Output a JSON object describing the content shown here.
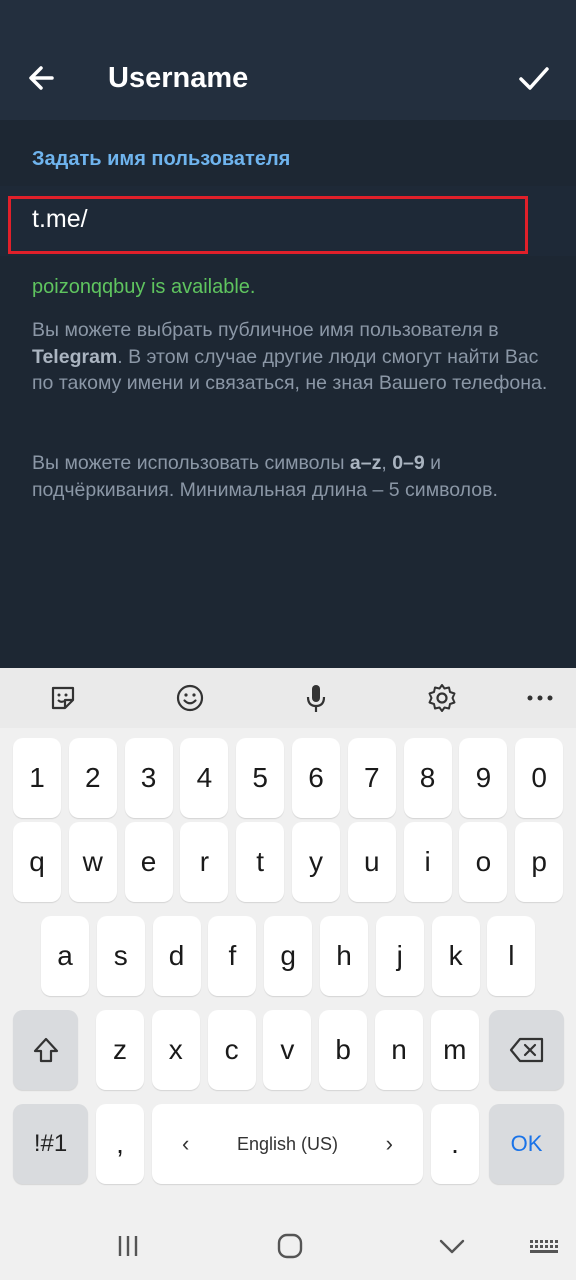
{
  "header": {
    "title": "Username"
  },
  "section_title": "Задать имя пользователя",
  "input": {
    "prefix": "t.me/",
    "value": ""
  },
  "status": "poizonqqbuy is available.",
  "help1": {
    "part1": "Вы можете выбрать публичное имя пользователя в ",
    "brand": "Telegram",
    "part2": ". В этом случае другие люди смогут найти Вас по такому имени и связаться, не зная Вашего телефона."
  },
  "help2": {
    "part1": "Вы можете использовать символы ",
    "chars": "a–z",
    "sep1": ", ",
    "digits": "0–9",
    "part2": " и подчёркивания. Минимальная длина – 5 символов."
  },
  "keyboard": {
    "toolbar": [
      "sticker-icon",
      "emoji-icon",
      "mic-icon",
      "settings-icon",
      "more-icon"
    ],
    "row_numbers": [
      "1",
      "2",
      "3",
      "4",
      "5",
      "6",
      "7",
      "8",
      "9",
      "0"
    ],
    "row1": [
      "q",
      "w",
      "e",
      "r",
      "t",
      "y",
      "u",
      "i",
      "o",
      "p"
    ],
    "row2": [
      "a",
      "s",
      "d",
      "f",
      "g",
      "h",
      "j",
      "k",
      "l"
    ],
    "row3": [
      "z",
      "x",
      "c",
      "v",
      "b",
      "n",
      "m"
    ],
    "symbols_label": "!#1",
    "comma": ",",
    "space_label": "English (US)",
    "space_left": "‹",
    "space_right": "›",
    "period": ".",
    "enter_label": "OK"
  },
  "colors": {
    "accent": "#6fb4ee",
    "available": "#5fc45f",
    "highlight": "#e0202a",
    "background": "#1d2733"
  }
}
